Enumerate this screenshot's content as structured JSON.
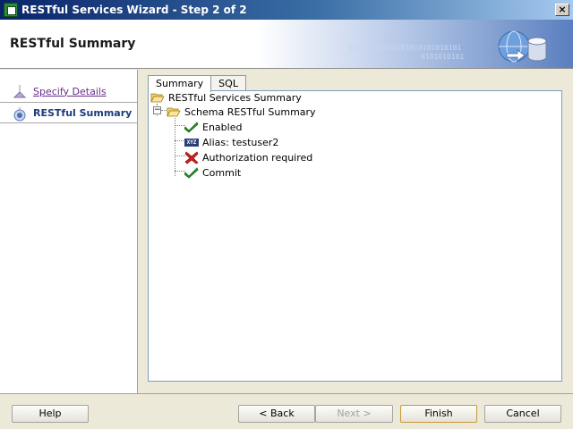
{
  "window": {
    "title": "RESTful Services Wizard - Step 2 of 2",
    "close_glyph": "×"
  },
  "header": {
    "page_title": "RESTful Summary",
    "binary_text_1": "01010101010101010101010101",
    "binary_text_2": "0101010101"
  },
  "nav": {
    "steps": [
      {
        "label": "Specify Details",
        "state": "visited"
      },
      {
        "label": "RESTful Summary",
        "state": "current"
      }
    ]
  },
  "tabs": [
    {
      "label": "Summary",
      "selected": true
    },
    {
      "label": "SQL",
      "selected": false
    }
  ],
  "tree": {
    "root": {
      "label": "RESTful Services Summary",
      "icon": "folder-open-icon"
    },
    "schema": {
      "label": "Schema RESTful Summary",
      "icon": "folder-open-icon",
      "expander": "−"
    },
    "items": [
      {
        "label": "Enabled",
        "icon": "checkmark-icon",
        "status": "ok"
      },
      {
        "label": "Alias: testuser2",
        "icon": "alias-icon",
        "badge": "XYZ"
      },
      {
        "label": "Authorization required",
        "icon": "cross-icon",
        "status": "no"
      },
      {
        "label": "Commit",
        "icon": "checkmark-icon",
        "status": "ok"
      }
    ]
  },
  "buttons": {
    "help": "Help",
    "back": "< Back",
    "next": "Next >",
    "finish": "Finish",
    "cancel": "Cancel"
  },
  "colors": {
    "ok": "#2a9a2a",
    "no": "#d02020",
    "link_visited": "#6a2c8c",
    "current_step": "#1c3a7a"
  }
}
